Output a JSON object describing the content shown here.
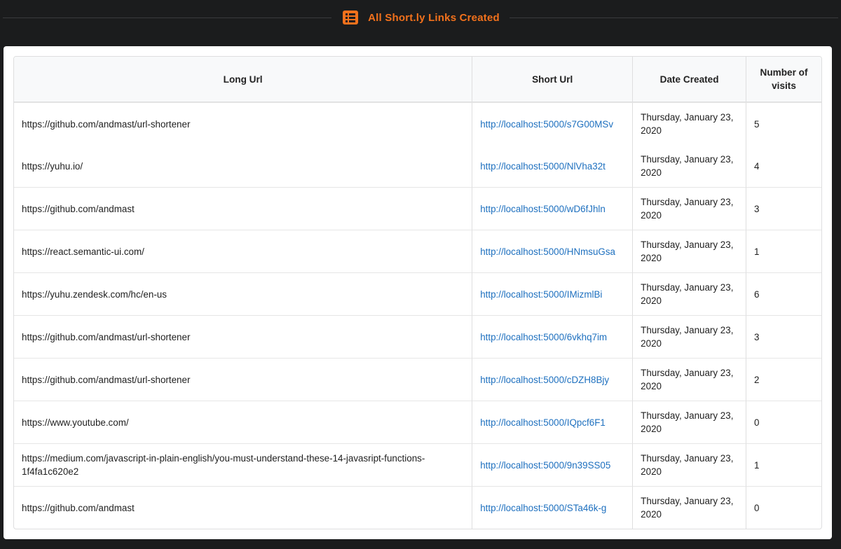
{
  "header": {
    "title": "All Short.ly Links Created",
    "icon": "list-icon",
    "accent_color": "#f2711c"
  },
  "table": {
    "columns": [
      "Long Url",
      "Short Url",
      "Date Created",
      "Number of visits"
    ],
    "rows": [
      {
        "long_url": "https://github.com/andmast/url-shortener",
        "short_url": "http://localhost:5000/s7G00MSv",
        "date": "Thursday, January 23, 2020",
        "visits": "5"
      },
      {
        "long_url": "https://yuhu.io/",
        "short_url": "http://localhost:5000/NlVha32t",
        "date": "Thursday, January 23, 2020",
        "visits": "4"
      },
      {
        "long_url": "https://github.com/andmast",
        "short_url": "http://localhost:5000/wD6fJhln",
        "date": "Thursday, January 23, 2020",
        "visits": "3"
      },
      {
        "long_url": "https://react.semantic-ui.com/",
        "short_url": "http://localhost:5000/HNmsuGsa",
        "date": "Thursday, January 23, 2020",
        "visits": "1"
      },
      {
        "long_url": "https://yuhu.zendesk.com/hc/en-us",
        "short_url": "http://localhost:5000/IMizmlBi",
        "date": "Thursday, January 23, 2020",
        "visits": "6"
      },
      {
        "long_url": "https://github.com/andmast/url-shortener",
        "short_url": "http://localhost:5000/6vkhq7im",
        "date": "Thursday, January 23, 2020",
        "visits": "3"
      },
      {
        "long_url": "https://github.com/andmast/url-shortener",
        "short_url": "http://localhost:5000/cDZH8Bjy",
        "date": "Thursday, January 23, 2020",
        "visits": "2"
      },
      {
        "long_url": "https://www.youtube.com/",
        "short_url": "http://localhost:5000/IQpcf6F1",
        "date": "Thursday, January 23, 2020",
        "visits": "0"
      },
      {
        "long_url": "https://medium.com/javascript-in-plain-english/you-must-understand-these-14-javasript-functions-1f4fa1c620e2",
        "short_url": "http://localhost:5000/9n39SS05",
        "date": "Thursday, January 23, 2020",
        "visits": "1"
      },
      {
        "long_url": "https://github.com/andmast",
        "short_url": "http://localhost:5000/STa46k-g",
        "date": "Thursday, January 23, 2020",
        "visits": "0"
      }
    ]
  }
}
